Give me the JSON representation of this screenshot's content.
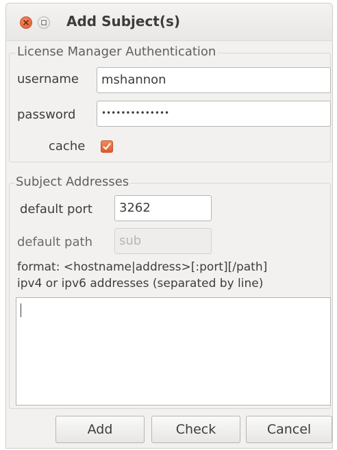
{
  "window": {
    "title": "Add Subject(s)"
  },
  "auth": {
    "legend": "License Manager Authentication",
    "username_label": "username",
    "username_value": "mshannon",
    "password_label": "password",
    "password_value": "••••••••••••••",
    "cache_label": "cache",
    "cache_checked": true
  },
  "subjects": {
    "legend": "Subject Addresses",
    "port_label": "default port",
    "port_value": "3262",
    "path_label": "default path",
    "path_placeholder": "sub",
    "format_line1": "format: <hostname|address>[:port][/path]",
    "format_line2": "ipv4 or ipv6 addresses (separated by line)",
    "addresses_value": ""
  },
  "buttons": {
    "add": "Add",
    "check": "Check",
    "cancel": "Cancel"
  },
  "colors": {
    "accent": "#e5622e",
    "window_bg": "#f2f1f0"
  }
}
